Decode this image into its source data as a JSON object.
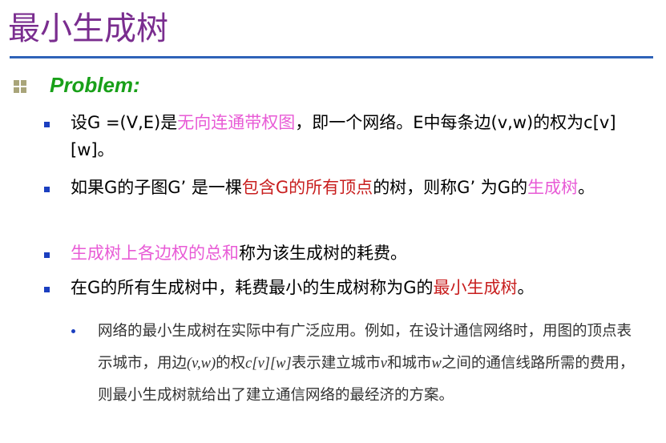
{
  "slide": {
    "title": "最小生成树",
    "problem_heading": "Problem:",
    "items": [
      {
        "parts": [
          {
            "text": "设G =(V,E)是",
            "style": "normal"
          },
          {
            "text": "无向连通带权图",
            "style": "pink"
          },
          {
            "text": "，即一个网络。E中每条边(v,w)的权为c[v][w]。",
            "style": "normal"
          }
        ]
      },
      {
        "parts": [
          {
            "text": "如果G的子图G’ 是一棵",
            "style": "normal"
          },
          {
            "text": "包含G的所有顶点",
            "style": "red"
          },
          {
            "text": "的树，则称G’ 为G的",
            "style": "normal"
          },
          {
            "text": "生成树",
            "style": "pink"
          },
          {
            "text": "。",
            "style": "normal"
          }
        ]
      },
      {
        "parts": [
          {
            "text": "生成树上各边权的总和",
            "style": "pink"
          },
          {
            "text": "称为该生成树的耗费。",
            "style": "normal"
          }
        ]
      },
      {
        "parts": [
          {
            "text": "在G的所有生成树中，耗费最小的生成树称为G的",
            "style": "normal"
          },
          {
            "text": "最小生成树",
            "style": "red"
          },
          {
            "text": "。",
            "style": "normal"
          }
        ]
      }
    ],
    "sub_item": {
      "parts": [
        {
          "text": "网络的最小生成树在实际中有广泛应用。例如，在设计通信网络时，用图的顶点表示城市，用边",
          "style": "normal"
        },
        {
          "text": "(v,w)",
          "style": "italic"
        },
        {
          "text": "的权",
          "style": "normal"
        },
        {
          "text": "c[v][w]",
          "style": "italic"
        },
        {
          "text": "表示建立城市",
          "style": "normal"
        },
        {
          "text": "v",
          "style": "italic"
        },
        {
          "text": "和城市",
          "style": "normal"
        },
        {
          "text": "w",
          "style": "italic"
        },
        {
          "text": "之间的通信线路所需的费用，则最小生成树就给出了建立通信网络的最经济的方案。",
          "style": "normal"
        }
      ]
    }
  },
  "colors": {
    "title": "#7a2d8f",
    "rule": "#2f63b8",
    "problem": "#19a019",
    "bullet": "#1b3fc0",
    "highlight_pink": "#e85bd6",
    "highlight_red": "#c81e1e"
  }
}
